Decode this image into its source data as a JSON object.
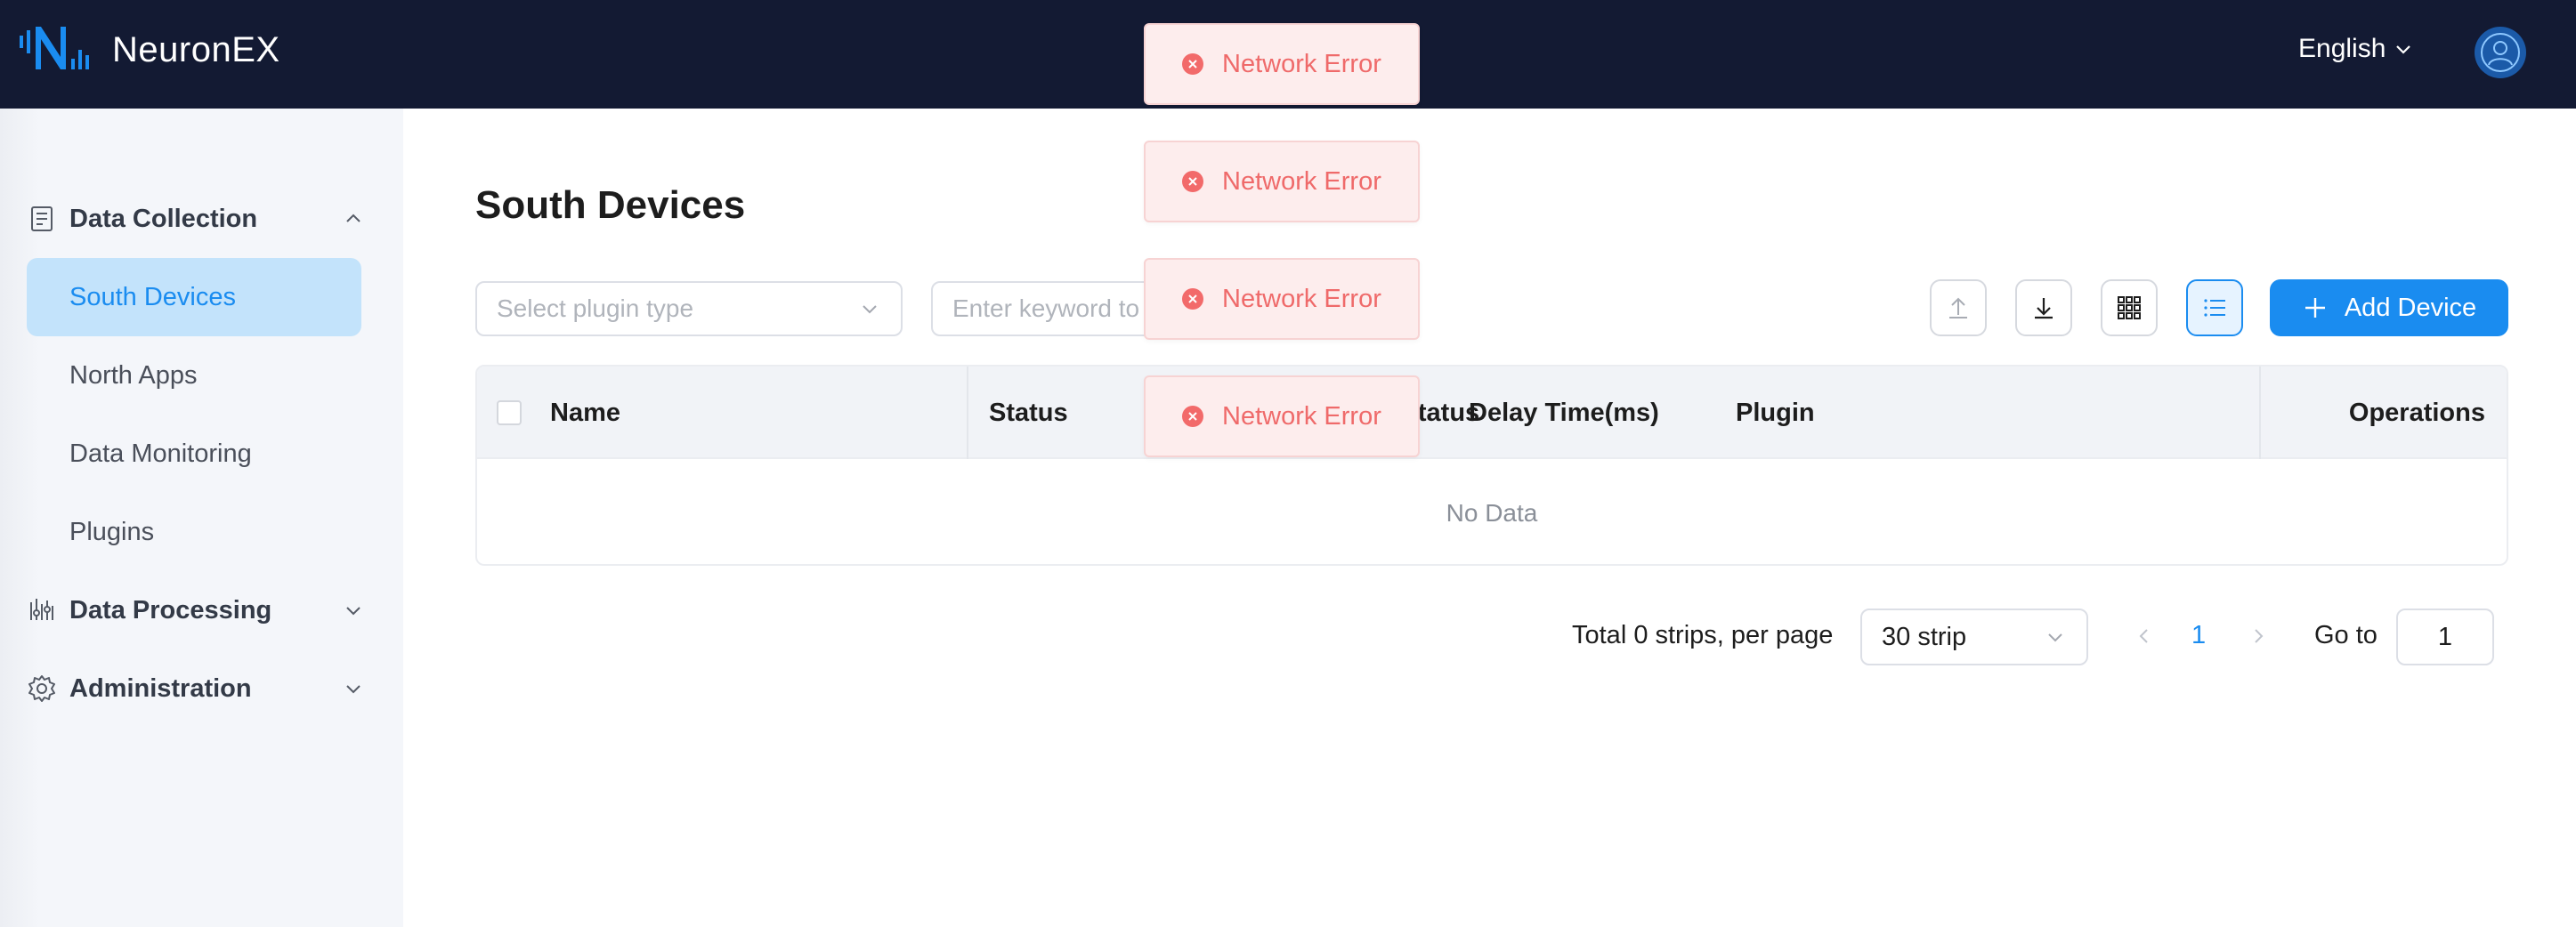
{
  "header": {
    "brand": "NeuronEX",
    "language": "English"
  },
  "sidebar": {
    "groups": [
      {
        "label": "Data Collection",
        "expanded": true
      },
      {
        "label": "Data Processing",
        "expanded": false
      },
      {
        "label": "Administration",
        "expanded": false
      }
    ],
    "items": [
      {
        "label": "South Devices",
        "active": true
      },
      {
        "label": "North Apps",
        "active": false
      },
      {
        "label": "Data Monitoring",
        "active": false
      },
      {
        "label": "Plugins",
        "active": false
      }
    ]
  },
  "main": {
    "title": "South Devices",
    "plugin_select_placeholder": "Select plugin type",
    "search_placeholder": "Enter keyword to search",
    "add_button_label": "Add Device",
    "table": {
      "columns": [
        "Name",
        "Status",
        "Connection Status",
        "Delay Time(ms)",
        "Plugin",
        "Operations"
      ],
      "empty_text": "No Data"
    },
    "pagination": {
      "total_text": "Total 0 strips, per page",
      "page_size": "30 strip",
      "current_page": "1",
      "goto_label": "Go to",
      "goto_value": "1"
    }
  },
  "toasts": [
    {
      "message": "Network Error"
    },
    {
      "message": "Network Error"
    },
    {
      "message": "Network Error"
    },
    {
      "message": "Network Error"
    }
  ],
  "colors": {
    "header_bg": "#131a33",
    "accent": "#1a8cf0",
    "active_nav_bg": "#c3e3fb",
    "error_text": "#ef6a6a",
    "error_bg": "#fdeded"
  }
}
